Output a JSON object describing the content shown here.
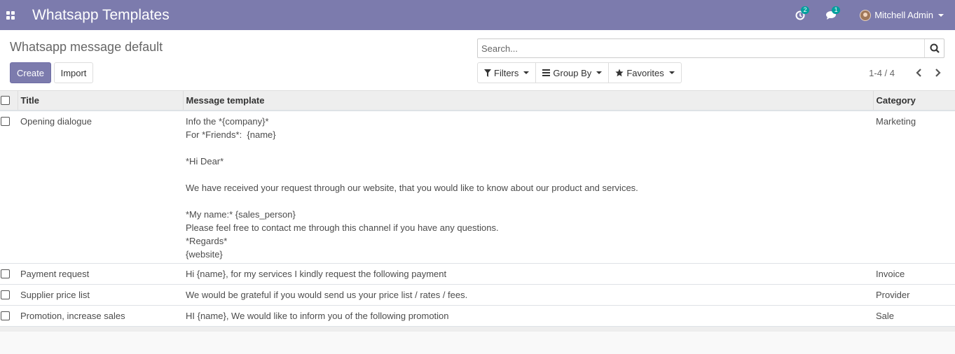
{
  "navbar": {
    "app_title": "Whatsapp Templates",
    "activity_count": "2",
    "messages_count": "1",
    "user_name": "Mitchell Admin",
    "color": "#7c7bad",
    "badge_color": "#00a09d"
  },
  "control_panel": {
    "breadcrumb": "Whatsapp message default",
    "create_label": "Create",
    "import_label": "Import",
    "search_placeholder": "Search...",
    "filters_label": "Filters",
    "group_by_label": "Group By",
    "favorites_label": "Favorites",
    "pager_value": "1-4 / 4"
  },
  "table": {
    "headers": {
      "title": "Title",
      "message": "Message template",
      "category": "Category"
    },
    "rows": [
      {
        "title": "Opening dialogue",
        "message_lines": [
          "Info the *{company}*",
          "For *Friends*:  {name}",
          "",
          "*Hi Dear*",
          "",
          "We have received your request through our website, that you would like to know about our product and services.",
          "",
          "*My name:* {sales_person}",
          "Please feel free to contact me through this channel if you have any questions.",
          "*Regards*",
          "{website}"
        ],
        "category": "Marketing"
      },
      {
        "title": "Payment request",
        "message_lines": [
          "Hi {name}, for my services I kindly request the following payment"
        ],
        "category": "Invoice"
      },
      {
        "title": "Supplier price list",
        "message_lines": [
          "We would be grateful if you would send us your price list / rates / fees."
        ],
        "category": "Provider"
      },
      {
        "title": "Promotion, increase sales",
        "message_lines": [
          "HI {name}, We would like to inform you of the following promotion"
        ],
        "category": "Sale"
      }
    ]
  }
}
